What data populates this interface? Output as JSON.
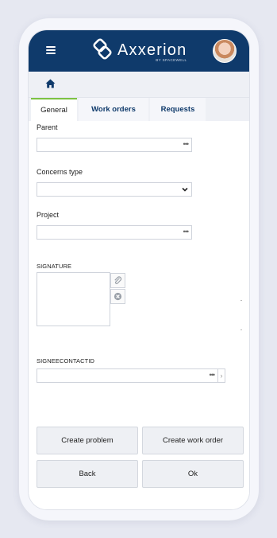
{
  "app": {
    "brand": "Axxerion",
    "brand_sub": "BY SPACEWELL"
  },
  "tabs": [
    {
      "label": "General"
    },
    {
      "label": "Work orders"
    },
    {
      "label": "Requests"
    }
  ],
  "form": {
    "parent_label": "Parent",
    "parent_value": "",
    "concerns_label": "Concerns type",
    "concerns_value": "",
    "project_label": "Project",
    "project_value": "",
    "signature_label": "SIGNATURE",
    "signee_label": "SIGNEECONTACTID",
    "signee_value": "",
    "lookup_glyph": "•••",
    "next_glyph": "›"
  },
  "buttons": {
    "create_problem": "Create problem",
    "create_work_order": "Create work order",
    "back": "Back",
    "ok": "Ok"
  },
  "colors": {
    "header": "#0f3a6b",
    "active_tab_accent": "#7dc243"
  },
  "icons": [
    "menu-icon",
    "axxerion-logo",
    "avatar",
    "home-icon",
    "chevron-down-icon",
    "attach-icon",
    "clear-icon"
  ]
}
